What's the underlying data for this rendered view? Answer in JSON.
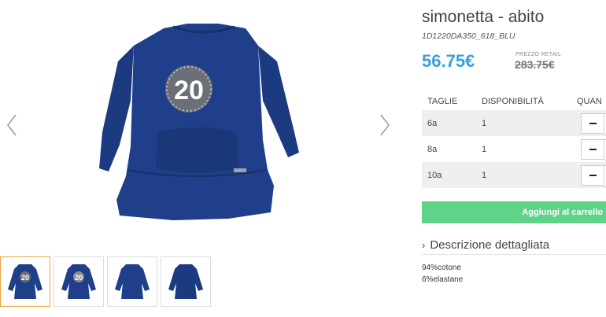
{
  "product": {
    "title": "simonetta - abito",
    "sku": "1D1220DA350_618_BLU",
    "price": "56.75€",
    "retail_label": "PREZZO RETAIL",
    "retail_price": "283.75€"
  },
  "gallery": {
    "print_number": "20",
    "thumbnails": [
      {
        "label": "20",
        "active": true
      },
      {
        "label": "20",
        "active": false
      },
      {
        "label": "",
        "active": false
      },
      {
        "label": "",
        "active": false
      }
    ]
  },
  "sizes": {
    "headers": [
      "TAGLIE",
      "DISPONIBILITÀ",
      "QUAN"
    ],
    "rows": [
      {
        "size": "6a",
        "availability": "1"
      },
      {
        "size": "8a",
        "availability": "1"
      },
      {
        "size": "10a",
        "availability": "1"
      }
    ]
  },
  "cart": {
    "label": "Aggiungi al carrello"
  },
  "description": {
    "toggle_label": "Descrizione dettagliata",
    "lines": [
      "94%cotone",
      "6%elastane"
    ]
  },
  "colors": {
    "price": "#3aa0d8",
    "cart": "#5fd38a",
    "dress": "#1f3f8a"
  }
}
